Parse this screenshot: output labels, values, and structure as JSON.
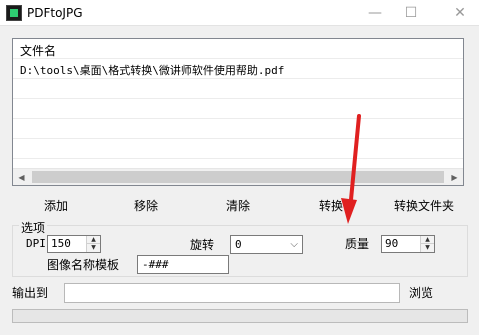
{
  "window": {
    "title": "PDFtoJPG",
    "minimize_glyph": "—",
    "maximize_glyph": "☐",
    "close_glyph": "✕"
  },
  "file_list": {
    "header": "文件名",
    "items": [
      "D:\\tools\\桌面\\格式转换\\微讲师软件使用帮助.pdf"
    ]
  },
  "actions": {
    "add": "添加",
    "remove": "移除",
    "clear": "清除",
    "convert": "转换",
    "convert_folder": "转换文件夹"
  },
  "options": {
    "group_label": "选项",
    "dpi_label": "DPI",
    "dpi_value": "150",
    "rotate_label": "旋转",
    "rotate_value": "0",
    "quality_label": "质量",
    "quality_value": "90",
    "template_label": "图像名称模板",
    "template_value": "-###"
  },
  "output": {
    "label": "输出到",
    "value": "",
    "browse": "浏览"
  },
  "progress": {
    "value": 0
  },
  "colors": {
    "annotation_arrow": "#e02020",
    "progress_fill": "#06b025"
  },
  "icons": {
    "app": "pdftojpg-app-icon",
    "spin_up": "▲",
    "spin_down": "▼",
    "dropdown": "⌵",
    "scroll_left": "◀",
    "scroll_right": "▶"
  }
}
